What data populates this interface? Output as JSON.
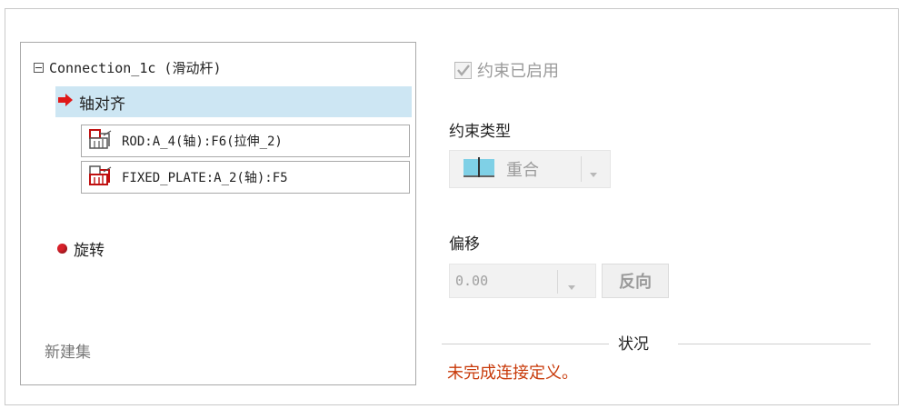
{
  "tree": {
    "connection_label": "Connection_1c (滑动杆)",
    "axis_align_label": "轴对齐",
    "references": [
      {
        "text": "ROD:A_4(轴):F6(拉伸_2)"
      },
      {
        "text": "FIXED_PLATE:A_2(轴):F5"
      }
    ],
    "rotate_label": "旋转",
    "new_set_label": "新建集"
  },
  "constraint": {
    "enabled_label": "约束已启用",
    "enabled_checked": true,
    "type_label": "约束类型",
    "type_value": "重合"
  },
  "offset": {
    "label": "偏移",
    "value": "0.00",
    "reverse_label": "反向"
  },
  "status": {
    "label": "状况",
    "message": "未完成连接定义。"
  },
  "colors": {
    "selection_bg": "#cde6f3",
    "status_message": "#c83a0a",
    "marker_red": "#d8202a"
  }
}
